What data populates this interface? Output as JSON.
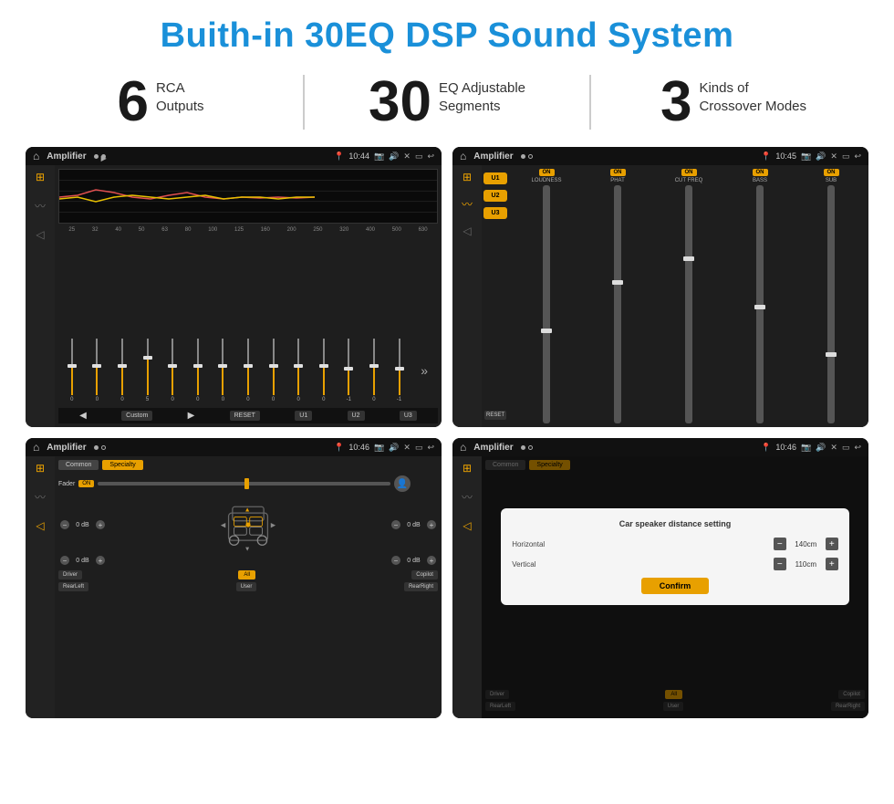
{
  "page": {
    "title": "Buith-in 30EQ DSP Sound System",
    "stats": [
      {
        "number": "6",
        "label": "RCA\nOutputs"
      },
      {
        "number": "30",
        "label": "EQ Adjustable\nSegments"
      },
      {
        "number": "3",
        "label": "Kinds of\nCrossover Modes"
      }
    ]
  },
  "screens": {
    "eq": {
      "title": "Amplifier",
      "time": "10:44",
      "freqs": [
        "25",
        "32",
        "40",
        "50",
        "63",
        "80",
        "100",
        "125",
        "160",
        "200",
        "250",
        "320",
        "400",
        "500",
        "630"
      ],
      "values": [
        "0",
        "0",
        "0",
        "5",
        "0",
        "0",
        "0",
        "0",
        "0",
        "0",
        "0",
        "-1",
        "0",
        "-1"
      ],
      "buttons": [
        "Custom",
        "RESET",
        "U1",
        "U2",
        "U3"
      ]
    },
    "crossover": {
      "title": "Amplifier",
      "time": "10:45",
      "presets": [
        "U1",
        "U2",
        "U3"
      ],
      "channels": [
        {
          "label": "LOUDNESS",
          "on": true
        },
        {
          "label": "PHAT",
          "on": true
        },
        {
          "label": "CUT FREQ",
          "on": true
        },
        {
          "label": "BASS",
          "on": true
        },
        {
          "label": "SUB",
          "on": true
        }
      ]
    },
    "fader": {
      "title": "Amplifier",
      "time": "10:46",
      "tabs": [
        "Common",
        "Specialty"
      ],
      "faderLabel": "Fader",
      "buttons": {
        "driver": "Driver",
        "copilot": "Copilot",
        "rearLeft": "RearLeft",
        "all": "All",
        "user": "User",
        "rearRight": "RearRight"
      }
    },
    "dialog": {
      "title": "Amplifier",
      "time": "10:46",
      "dialogTitle": "Car speaker distance setting",
      "rows": [
        {
          "label": "Horizontal",
          "value": "140cm"
        },
        {
          "label": "Vertical",
          "value": "110cm"
        }
      ],
      "confirmLabel": "Confirm",
      "buttons": {
        "driver": "Driver",
        "copilot": "Copilot",
        "rearLeft": "RearLeft",
        "all": "All",
        "user": "User",
        "rearRight": "RearRight"
      }
    }
  },
  "icons": {
    "home": "⌂",
    "back": "↩",
    "equalizer": "≋",
    "waveform": "〰",
    "volume": "◁",
    "settings": "⊙",
    "play": "▶",
    "prev": "◀",
    "next": "▶▶",
    "camera": "📷",
    "speaker": "🔊",
    "x": "✕",
    "window": "⬜",
    "expand": "⤢"
  }
}
